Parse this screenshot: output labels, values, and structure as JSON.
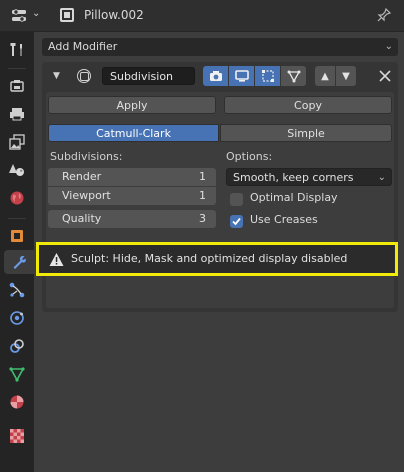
{
  "header": {
    "object_name": "Pillow.002",
    "editor_icon": "properties-editor-icon",
    "pin_icon": "pin-icon"
  },
  "sidebar": {
    "tabs": [
      {
        "name": "tool-tab",
        "icon": "tool-icon"
      },
      {
        "name": "render-tab",
        "icon": "camera-back-icon"
      },
      {
        "name": "output-tab",
        "icon": "printer-icon"
      },
      {
        "name": "view-layer-tab",
        "icon": "image-stack-icon"
      },
      {
        "name": "scene-tab",
        "icon": "cone-sphere-icon"
      },
      {
        "name": "world-tab",
        "icon": "globe-icon"
      },
      {
        "name": "object-tab",
        "icon": "cube-icon"
      },
      {
        "name": "modifiers-tab",
        "icon": "wrench-icon",
        "active": true
      },
      {
        "name": "particles-tab",
        "icon": "particles-icon"
      },
      {
        "name": "physics-tab",
        "icon": "physics-orbit-icon"
      },
      {
        "name": "constraints-tab",
        "icon": "constraint-icon"
      },
      {
        "name": "object-data-tab",
        "icon": "mesh-triangle-icon"
      },
      {
        "name": "material-tab",
        "icon": "material-sphere-icon"
      },
      {
        "name": "texture-tab",
        "icon": "checker-texture-icon"
      }
    ]
  },
  "add_modifier": {
    "label": "Add Modifier"
  },
  "modifier": {
    "name": "Subdivision",
    "apply_label": "Apply",
    "copy_label": "Copy",
    "algorithm": {
      "options": [
        "Catmull-Clark",
        "Simple"
      ],
      "selected": "Catmull-Clark"
    },
    "subdivisions_label": "Subdivisions:",
    "render": {
      "label": "Render",
      "value": "1"
    },
    "viewport": {
      "label": "Viewport",
      "value": "1"
    },
    "quality": {
      "label": "Quality",
      "value": "3"
    },
    "options_label": "Options:",
    "uv_smooth": "Smooth, keep corners",
    "optimal_display": {
      "label": "Optimal Display",
      "checked": false
    },
    "use_creases": {
      "label": "Use Creases",
      "checked": true
    }
  },
  "warning": {
    "text": "Sculpt: Hide, Mask and optimized display disabled",
    "highlight_color": "#f2ea08"
  },
  "colors": {
    "accent": "#4772b3",
    "panel": "#3d3d3d",
    "sidebar": "#242424"
  }
}
